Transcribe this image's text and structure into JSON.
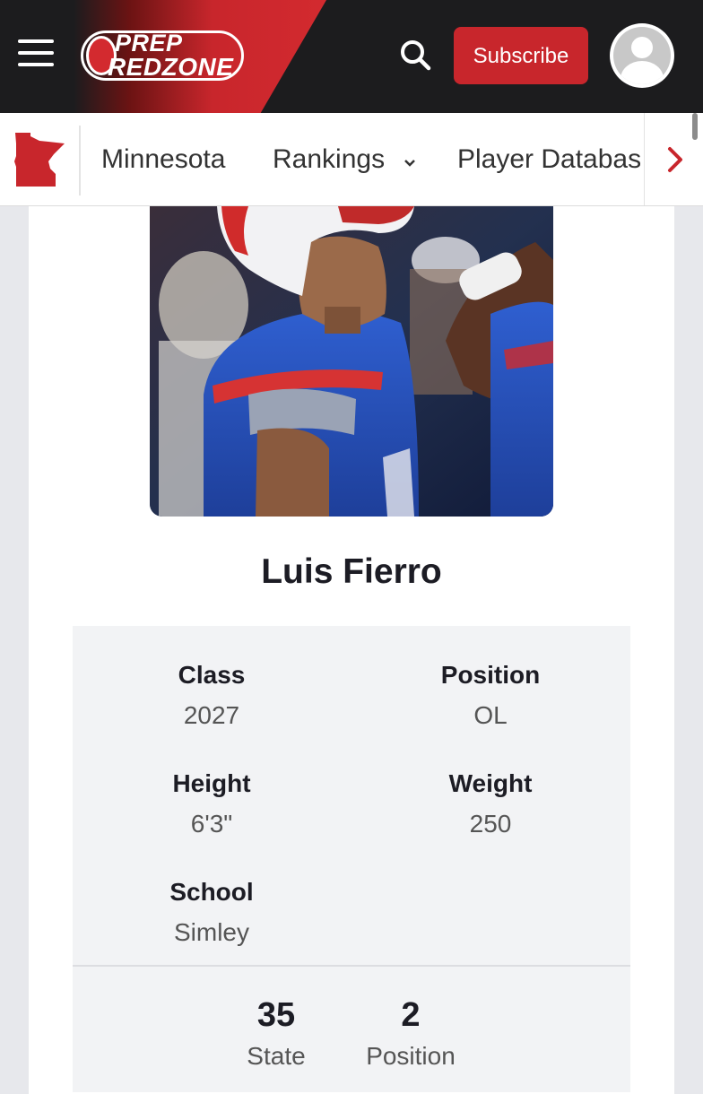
{
  "header": {
    "logo_line1": "PREP",
    "logo_line2": "REDZONE",
    "subscribe_label": "Subscribe",
    "icons": [
      "menu-icon",
      "search-icon",
      "user-avatar-icon"
    ],
    "accent_color": "#c8262c"
  },
  "subnav": {
    "state_icon": "minnesota-state-icon",
    "items": [
      {
        "label": "Minnesota"
      },
      {
        "label": "Rankings",
        "icon": "chevron-down-icon"
      },
      {
        "label": "Player Databas"
      }
    ],
    "scroll_icon": "chevron-right-icon"
  },
  "player": {
    "name": "Luis Fierro",
    "details": [
      {
        "label": "Class",
        "value": "2027"
      },
      {
        "label": "Position",
        "value": "OL"
      },
      {
        "label": "Height",
        "value": "6'3\""
      },
      {
        "label": "Weight",
        "value": "250"
      },
      {
        "label": "School",
        "value": "Simley"
      }
    ],
    "rankings": [
      {
        "value": "35",
        "label": "State"
      },
      {
        "value": "2",
        "label": "Position"
      }
    ]
  }
}
